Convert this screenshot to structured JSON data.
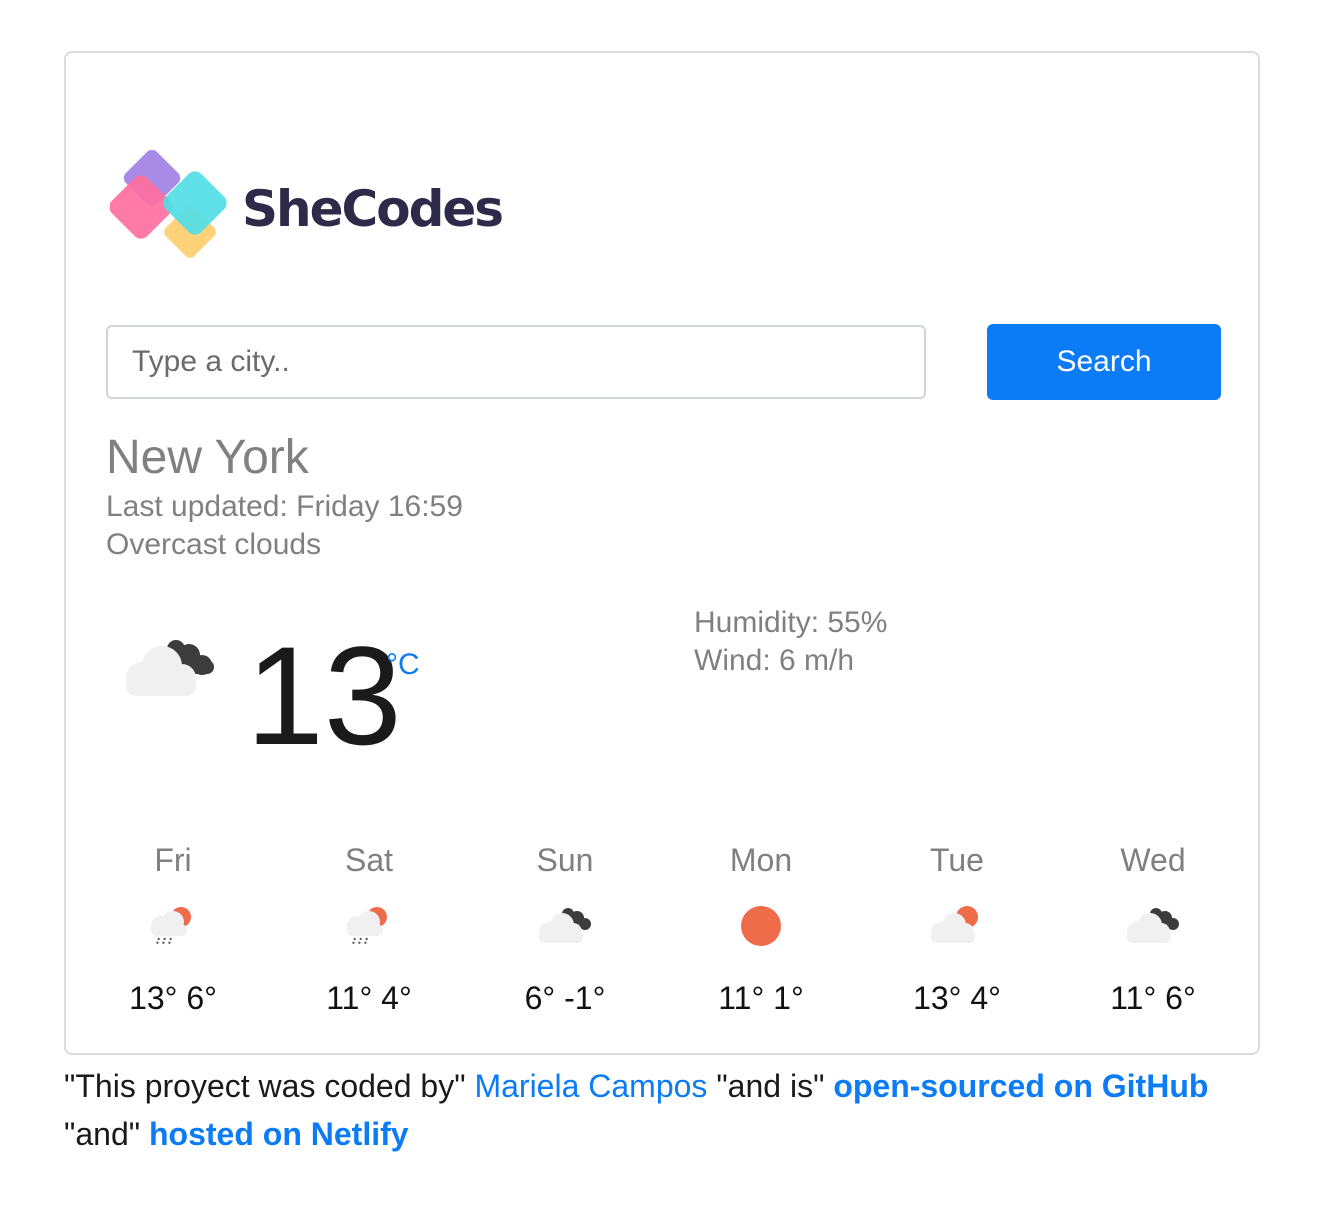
{
  "logo": {
    "text": "SheCodes"
  },
  "search": {
    "placeholder": "Type a city..",
    "value": "",
    "button_label": "Search"
  },
  "current": {
    "city": "New York",
    "last_updated": "Last updated: Friday 16:59",
    "description": "Overcast clouds",
    "icon": "overcast-clouds-icon",
    "temperature": "13",
    "unit": "°C",
    "humidity": "Humidity: 55%",
    "wind": "Wind: 6 m/h"
  },
  "forecast": [
    {
      "day": "Fri",
      "icon": "rain-sun-icon",
      "temps": "13° 6°"
    },
    {
      "day": "Sat",
      "icon": "rain-sun-icon",
      "temps": "11° 4°"
    },
    {
      "day": "Sun",
      "icon": "overcast-clouds-icon",
      "temps": "6° -1°"
    },
    {
      "day": "Mon",
      "icon": "sun-icon",
      "temps": "11° 1°"
    },
    {
      "day": "Tue",
      "icon": "cloud-sun-icon",
      "temps": "13° 4°"
    },
    {
      "day": "Wed",
      "icon": "overcast-clouds-icon",
      "temps": "11° 6°"
    }
  ],
  "footer": {
    "part1": "\"This proyect was coded by\" ",
    "author": "Mariela Campos",
    "part2": " \"and is\" ",
    "github_link": "open-sourced on GitHub",
    "part3": " \"and\" ",
    "netlify_link": "hosted on Netlify"
  },
  "colors": {
    "accent": "#0b7cf5",
    "sun": "#ef6c4a",
    "dark_cloud": "#3c3c3c",
    "light_cloud": "#f0f0f0"
  }
}
